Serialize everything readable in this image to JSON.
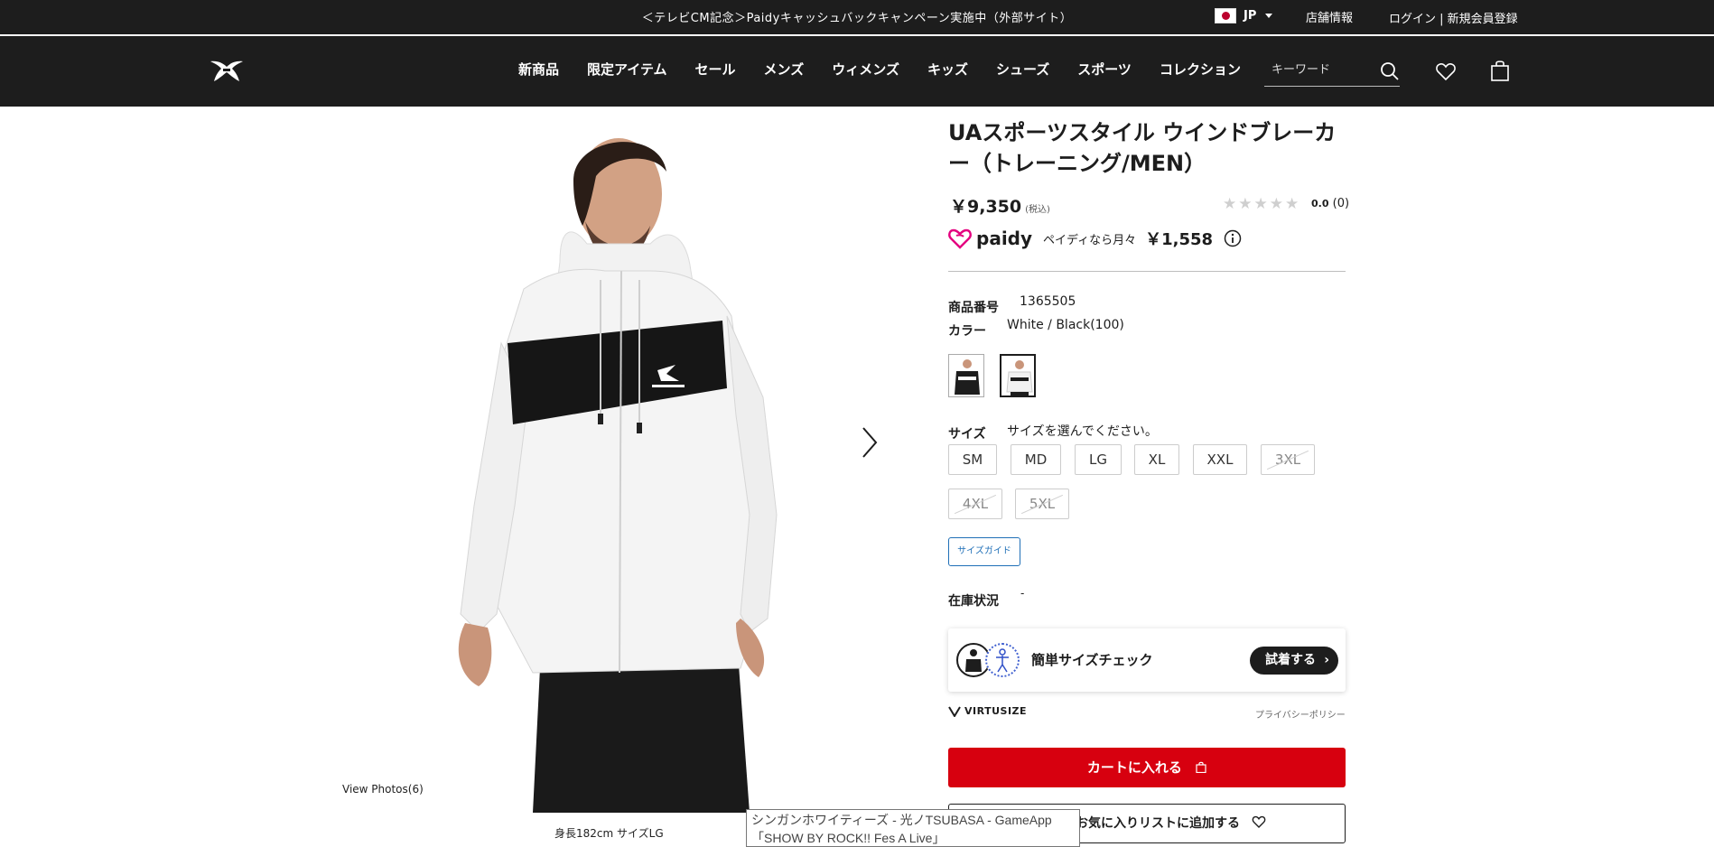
{
  "topbar": {
    "promo": "＜テレビCM記念＞Paidyキャッシュバックキャンペーン実施中（外部サイト）",
    "country": "JP",
    "store_info": "店舗情報",
    "login": "ログイン | 新規会員登録"
  },
  "nav": {
    "items": [
      "新商品",
      "限定アイテム",
      "セール",
      "メンズ",
      "ウィメンズ",
      "キッズ",
      "シューズ",
      "スポーツ",
      "コレクション"
    ],
    "search_placeholder": "キーワード"
  },
  "gallery": {
    "view_photos": "View Photos(6)",
    "caption": "身長182cm サイズLG"
  },
  "product": {
    "title": "UAスポーツスタイル ウインドブレーカー（トレーニング/MEN）",
    "price": "￥9,350",
    "tax_note": "(税込)",
    "rating_score": "0.0",
    "rating_count": "(0)",
    "rating_stars": 0,
    "paidy_brand": "paidy",
    "paidy_text": "ペイディなら月々",
    "paidy_amount": "￥1,558",
    "product_number_label": "商品番号",
    "product_number": "1365505",
    "color_label": "カラー",
    "color_value": "White / Black(100)",
    "size_label": "サイズ",
    "size_prompt": "サイズを選んでください。",
    "sizes": [
      {
        "label": "SM",
        "available": true
      },
      {
        "label": "MD",
        "available": true
      },
      {
        "label": "LG",
        "available": true
      },
      {
        "label": "XL",
        "available": true
      },
      {
        "label": "XXL",
        "available": true
      },
      {
        "label": "3XL",
        "available": false
      },
      {
        "label": "4XL",
        "available": false
      },
      {
        "label": "5XL",
        "available": false
      }
    ],
    "size_guide": "サイズガイド",
    "stock_label": "在庫状況",
    "stock_value": "-"
  },
  "virtusize": {
    "title": "簡単サイズチェック",
    "try_button": "試着する",
    "brand": "VIRTUSIZE",
    "privacy": "プライバシーポリシー"
  },
  "actions": {
    "add_to_cart": "カートに入れる",
    "add_to_wishlist": "お気に入りリストに追加する"
  },
  "tooltip": "シンガンホワイティーズ - 光ノTSUBASA - GameApp「SHOW BY ROCK!! Fes A Live」",
  "colors": {
    "header_bg": "#1d1d1d",
    "cart_red": "#d7000f",
    "link_blue": "#1f6fb7"
  }
}
